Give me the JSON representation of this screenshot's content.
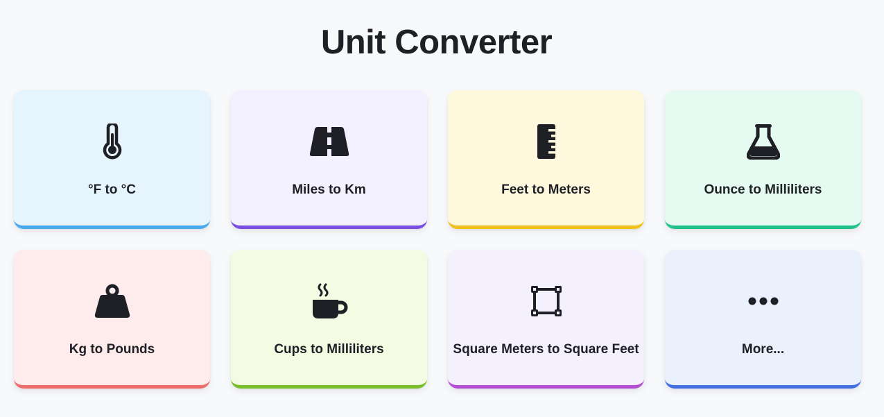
{
  "page": {
    "title": "Unit Converter"
  },
  "cards": [
    {
      "label": "°F to °C",
      "icon": "thermometer-icon",
      "bg": "#e6f4fe",
      "accent": "#4aa8ec"
    },
    {
      "label": "Miles to Km",
      "icon": "road-icon",
      "bg": "#f3f0ff",
      "accent": "#7a4ee0"
    },
    {
      "label": "Feet to Meters",
      "icon": "ruler-icon",
      "bg": "#fef9dc",
      "accent": "#f2bf19"
    },
    {
      "label": "Ounce to Milliliters",
      "icon": "flask-icon",
      "bg": "#e5fbf1",
      "accent": "#22c08a"
    },
    {
      "label": "Kg to Pounds",
      "icon": "weight-icon",
      "bg": "#feebeb",
      "accent": "#f06c6c"
    },
    {
      "label": "Cups to Milliliters",
      "icon": "coffee-cup-icon",
      "bg": "#f3fbe2",
      "accent": "#79c02a"
    },
    {
      "label": "Square Meters to Square Feet",
      "icon": "square-area-icon",
      "bg": "#f4f0fd",
      "accent": "#b44fd6"
    },
    {
      "label": "More...",
      "icon": "more-icon",
      "bg": "#ebf0fd",
      "accent": "#4470e4"
    }
  ]
}
